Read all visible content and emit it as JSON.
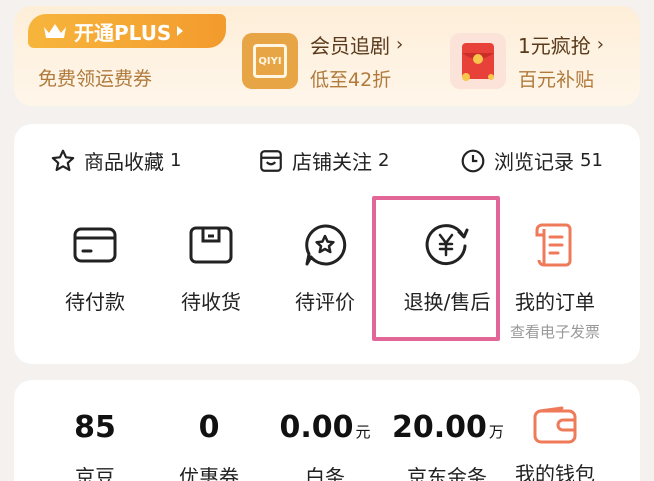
{
  "promo": {
    "plus_label": "开通PLUS",
    "plus_sub": "免费领运费券",
    "items": [
      {
        "title": "会员追剧",
        "sub": "低至42折",
        "thumb_text": "QIYI"
      },
      {
        "title": "1元疯抢",
        "sub": "百元补贴"
      }
    ],
    "chevron": "›"
  },
  "shortcuts": [
    {
      "label": "商品收藏",
      "count": "1",
      "icon": "star-icon"
    },
    {
      "label": "店铺关注",
      "count": "2",
      "icon": "store-icon"
    },
    {
      "label": "浏览记录",
      "count": "51",
      "icon": "clock-icon"
    }
  ],
  "orders": [
    {
      "label": "待付款",
      "icon": "wallet-card-icon"
    },
    {
      "label": "待收货",
      "icon": "package-icon"
    },
    {
      "label": "待评价",
      "icon": "review-star-bubble-icon"
    },
    {
      "label": "退换/售后",
      "icon": "yen-refresh-icon"
    },
    {
      "label": "我的订单",
      "sub": "查看电子发票",
      "icon": "order-list-icon"
    }
  ],
  "wallet": [
    {
      "value": "85",
      "unit": "",
      "label": "京豆"
    },
    {
      "value": "0",
      "unit": "",
      "label": "优惠券"
    },
    {
      "value": "0.00",
      "unit": "元",
      "label": "白条"
    },
    {
      "value": "20.00",
      "unit": "万",
      "label": "京东金条"
    },
    {
      "label": "我的钱包",
      "icon": "wallet-icon"
    }
  ],
  "colors": {
    "accent_gold": "#f39b2d",
    "highlight": "#e26798",
    "orange_icon": "#ef7a5a"
  }
}
